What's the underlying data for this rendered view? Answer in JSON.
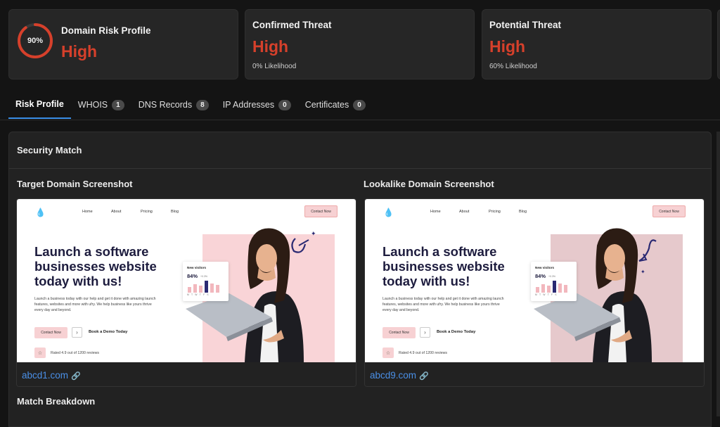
{
  "risk_profile": {
    "percent": "90%",
    "percent_value": 0.9,
    "title": "Domain Risk Profile",
    "level": "High"
  },
  "confirmed": {
    "title": "Confirmed Threat",
    "level": "High",
    "sub": "0% Likelihood"
  },
  "potential": {
    "title": "Potential Threat",
    "level": "High",
    "sub": "60% Likelihood"
  },
  "tabs": [
    {
      "label": "Risk Profile",
      "count": ""
    },
    {
      "label": "WHOIS",
      "count": "1"
    },
    {
      "label": "DNS Records",
      "count": "8"
    },
    {
      "label": "IP Addresses",
      "count": "0"
    },
    {
      "label": "Certificates",
      "count": "0"
    }
  ],
  "section": {
    "title": "Security Match",
    "breakdown": "Match Breakdown"
  },
  "target": {
    "label": "Target Domain Screenshot",
    "domain": "abcd1.com",
    "site": {
      "nav": [
        "Home",
        "About",
        "Pricing",
        "Blog"
      ],
      "cta": "Contact Now",
      "headline": "Launch a software businesses website today with us!",
      "paragraph": "Launch a business today with our help and get it done with amazing launch features, websites and more with ufry. We help business like yours thrive every day and beyond.",
      "button": "Contact Now",
      "demo": "Book a Demo Today",
      "rated": "Rated 4.9 out of 1200 reviews",
      "visitors_title": "New visitors",
      "visitors_value": "84%",
      "visitors_small": "+0.3%",
      "days": "MTWTFS"
    }
  },
  "lookalike": {
    "label": "Lookalike Domain Screenshot",
    "domain": "abcd9.com",
    "site": {
      "nav": [
        "Home",
        "About",
        "Pricing",
        "Blog"
      ],
      "cta": "Contact Now",
      "headline": "Launch a software businesses website today with us!",
      "paragraph": "Launch a business today with our help and get it done with amazing launch features, websites and more with ufry. We help business like yours thrive every day and beyond.",
      "button": "Contact Now",
      "demo": "Book a Demo Today",
      "rated": "Rated 4.9 out of 1200 reviews",
      "visitors_title": "New visitors",
      "visitors_value": "84%",
      "visitors_small": "+0.3%",
      "days": "MTWTFS"
    }
  },
  "colors": {
    "accent": "#3a8ee6",
    "danger": "#d6402b",
    "link": "#4a8fe6"
  },
  "icons": {
    "link": "link-icon",
    "star": "star-icon",
    "arrow": "arrow-right-icon",
    "logo": "drop-logo-icon"
  }
}
